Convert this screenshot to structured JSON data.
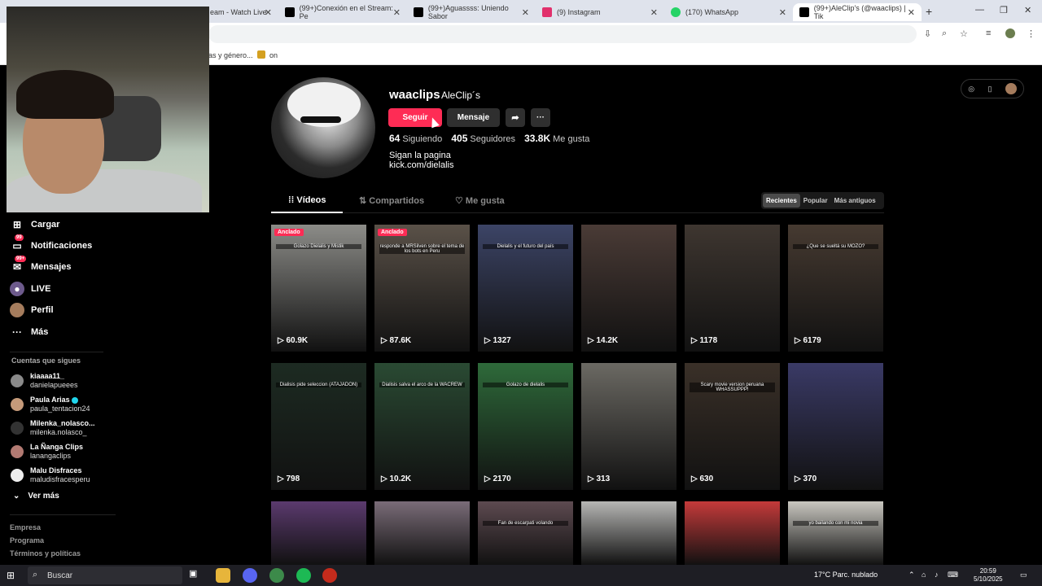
{
  "browser": {
    "tabs": [
      {
        "label": "eam - Watch Live",
        "color": "#9146ff"
      },
      {
        "label": "(99+)Conexión en el Stream: Pe",
        "color": "#000000"
      },
      {
        "label": "(99+)Aguassss: Uniendo Sabor",
        "color": "#000000"
      },
      {
        "label": "(9) Instagram",
        "color": "#e1306c"
      },
      {
        "label": "(170) WhatsApp",
        "color": "#25d366"
      },
      {
        "label": "(99+)AleClip's (@waaclips) | Tik",
        "color": "#000000"
      }
    ],
    "new_tab": "+",
    "bookmarks": [
      "as y género...",
      "on"
    ]
  },
  "sidebar": {
    "items": [
      {
        "label": "Cargar",
        "icon": "plus-square-icon",
        "badge": ""
      },
      {
        "label": "Notificaciones",
        "icon": "inbox-icon",
        "badge": "99"
      },
      {
        "label": "Mensajes",
        "icon": "message-icon",
        "badge": "99+"
      },
      {
        "label": "LIVE",
        "icon": "live-icon",
        "badge": ""
      },
      {
        "label": "Perfil",
        "icon": "profile-icon",
        "badge": ""
      },
      {
        "label": "Más",
        "icon": "more-icon",
        "badge": ""
      }
    ],
    "following_title": "Cuentas que sigues",
    "following": [
      {
        "name": "kiaaaa11_",
        "user": "danielapueees",
        "verified": false
      },
      {
        "name": "Paula Arias",
        "user": "paula_tentacion24",
        "verified": true
      },
      {
        "name": "Milenka_nolasco...",
        "user": "milenka.nolasco_",
        "verified": false
      },
      {
        "name": "La Ñanga Clips",
        "user": "lanangaclips",
        "verified": false
      },
      {
        "name": "Malu Disfraces",
        "user": "maludisfracesperu",
        "verified": false
      }
    ],
    "see_more": "Ver más",
    "footer": [
      "Empresa",
      "Programa",
      "Términos y políticas"
    ]
  },
  "profile": {
    "username": "waaclips",
    "nickname": "AleClip´s",
    "follow_label": "Seguir",
    "message_label": "Mensaje",
    "more_label": "···",
    "following_count": "64",
    "following_label": "Siguiendo",
    "followers_count": "405",
    "followers_label": "Seguidores",
    "likes_count": "33.8K",
    "likes_label": "Me gusta",
    "bio_line1": "Sigan la pagina",
    "bio_line2": "kick.com/dielalis"
  },
  "tabs": {
    "videos": "Vídeos",
    "reposts": "Compartidos",
    "liked": "Me gusta"
  },
  "sort": {
    "recent": "Recientes",
    "popular": "Popular",
    "oldest": "Más antiguos"
  },
  "pinned_label": "Anclado",
  "videos": [
    {
      "views": "60.9K",
      "pinned": true,
      "caption": "Golazo Dielalis y Mistik",
      "color": "#8c8c88"
    },
    {
      "views": "87.6K",
      "pinned": true,
      "caption": "responde a MRSilven sobre el tema de los bots en Peru",
      "color": "#5a5148"
    },
    {
      "views": "1327",
      "pinned": false,
      "caption": "Dielalis y el futuro del país",
      "color": "#3c4466"
    },
    {
      "views": "14.2K",
      "pinned": false,
      "caption": "",
      "color": "#4a3b36"
    },
    {
      "views": "1178",
      "pinned": false,
      "caption": "",
      "color": "#3e3630"
    },
    {
      "views": "6179",
      "pinned": false,
      "caption": "¿Que se sueltá su MOZO?",
      "color": "#463a31"
    },
    {
      "views": "798",
      "pinned": false,
      "caption": "Dialisis pide seleccion (ATAJADON)",
      "color": "#1d2b22"
    },
    {
      "views": "10.2K",
      "pinned": false,
      "caption": "Dialisis salva el arco de la WACREW",
      "color": "#2a4a33"
    },
    {
      "views": "2170",
      "pinned": false,
      "caption": "Golazo de dielalis",
      "color": "#2e6a3a"
    },
    {
      "views": "313",
      "pinned": false,
      "caption": "",
      "color": "#6b6963"
    },
    {
      "views": "630",
      "pinned": false,
      "caption": "Scary movie version peruana WHASSUPPP!",
      "color": "#3a3028"
    },
    {
      "views": "370",
      "pinned": false,
      "caption": "",
      "color": "#3a3a66"
    },
    {
      "views": "",
      "pinned": false,
      "caption": "",
      "color": "#5b3a6e"
    },
    {
      "views": "",
      "pinned": false,
      "caption": "",
      "color": "#7a6c78"
    },
    {
      "views": "",
      "pinned": false,
      "caption": "Fan de escarpati volando",
      "color": "#5d4a50"
    },
    {
      "views": "",
      "pinned": false,
      "caption": "",
      "color": "#b6b6b4"
    },
    {
      "views": "",
      "pinned": false,
      "caption": "",
      "color": "#c43a3a"
    },
    {
      "views": "",
      "pinned": false,
      "caption": "yo bailando con mi novia",
      "color": "#c9c7c0"
    }
  ],
  "taskbar": {
    "search": "Buscar",
    "weather": "17°C  Parc. nublado",
    "time": "20:59",
    "date": "5/10/2025"
  },
  "colors": {
    "accent": "#fe2c55",
    "background": "#000000"
  }
}
